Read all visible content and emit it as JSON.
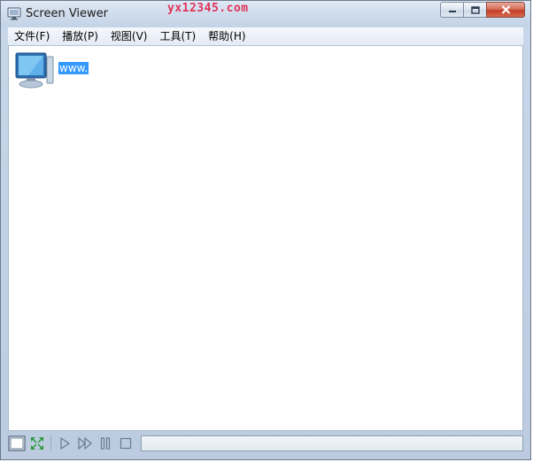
{
  "window": {
    "title": "Screen Viewer",
    "watermark": "yx12345.com"
  },
  "menu": [
    {
      "label": "文件(F)"
    },
    {
      "label": "播放(P)"
    },
    {
      "label": "视图(V)"
    },
    {
      "label": "工具(T)"
    },
    {
      "label": "帮助(H)"
    }
  ],
  "content": {
    "items": [
      {
        "label": "www.",
        "icon": "computer-icon",
        "selected": true
      }
    ]
  },
  "toolbar": {
    "buttons": [
      {
        "icon": "window-view-icon"
      },
      {
        "icon": "fullscreen-icon"
      },
      {
        "icon": "play-icon"
      },
      {
        "icon": "fast-forward-icon"
      },
      {
        "icon": "pause-icon"
      },
      {
        "icon": "stop-icon"
      }
    ],
    "progress": 0
  },
  "colors": {
    "selection": "#3399ff",
    "watermark": "#e0325a",
    "close_button": "#c43e28"
  }
}
